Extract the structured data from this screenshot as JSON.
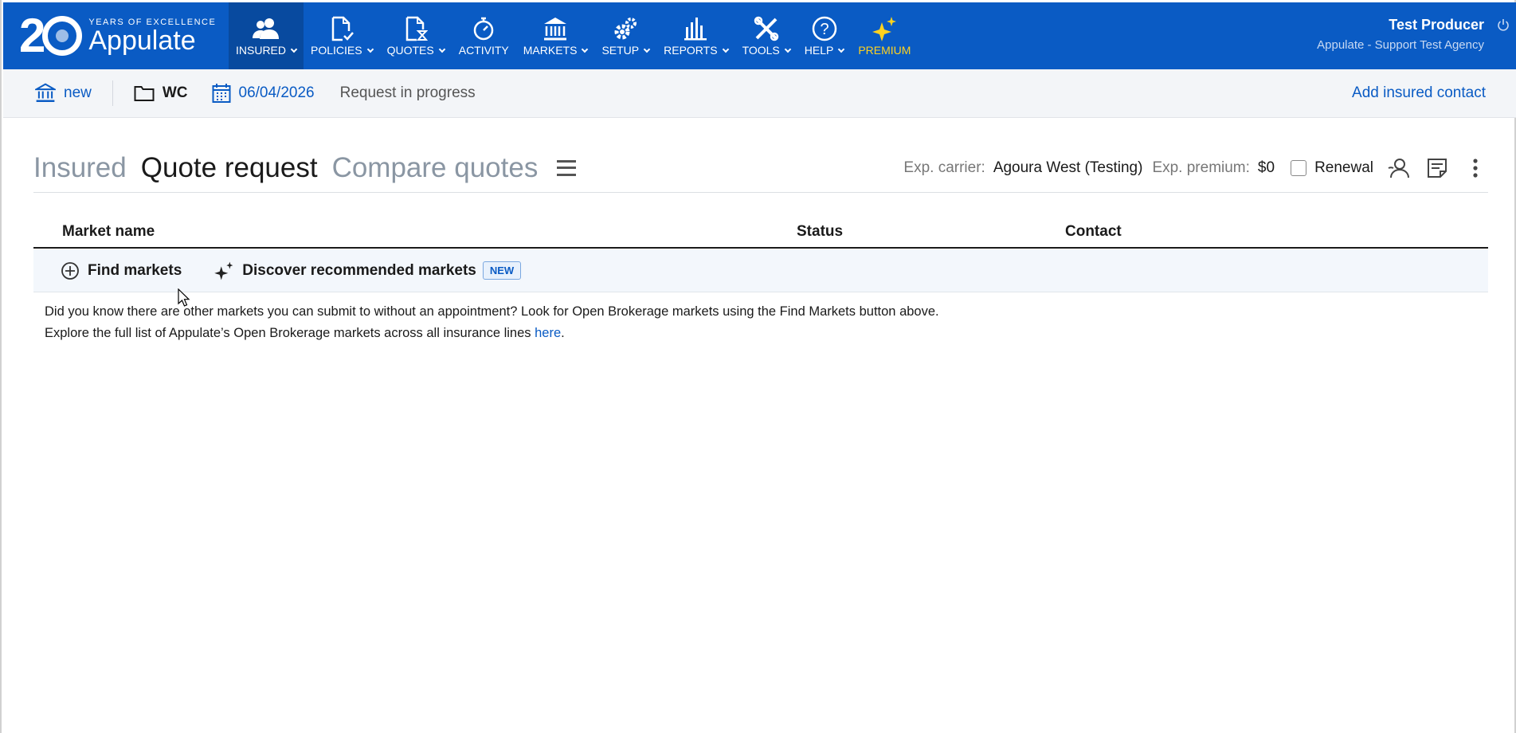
{
  "logo": {
    "years": "20",
    "subtitle": "YEARS OF EXCELLENCE",
    "name": "Appulate"
  },
  "nav": [
    {
      "label": "INSURED",
      "icon": "users-icon",
      "caret": true
    },
    {
      "label": "POLICIES",
      "icon": "document-check-icon",
      "caret": true
    },
    {
      "label": "QUOTES",
      "icon": "document-hourglass-icon",
      "caret": true
    },
    {
      "label": "ACTIVITY",
      "icon": "stopwatch-icon",
      "caret": false
    },
    {
      "label": "MARKETS",
      "icon": "bank-icon",
      "caret": true
    },
    {
      "label": "SETUP",
      "icon": "gears-icon",
      "caret": true
    },
    {
      "label": "REPORTS",
      "icon": "bar-chart-icon",
      "caret": true
    },
    {
      "label": "TOOLS",
      "icon": "wrench-screwdriver-icon",
      "caret": true
    },
    {
      "label": "HELP",
      "icon": "question-circle-icon",
      "caret": true
    },
    {
      "label": "PREMIUM",
      "icon": "sparkle-icon",
      "caret": false
    }
  ],
  "user": {
    "name": "Test Producer",
    "agency": "Appulate - Support Test Agency"
  },
  "subbar": {
    "insured_label": "new",
    "line": "WC",
    "date": "06/04/2026",
    "status": "Request in progress",
    "add_contact": "Add insured contact"
  },
  "tabs": {
    "insured": "Insured",
    "quote_request": "Quote request",
    "compare": "Compare quotes"
  },
  "exp": {
    "carrier_label": "Exp. carrier:",
    "carrier_value": "Agoura West (Testing)",
    "premium_label": "Exp. premium:",
    "premium_value": "$0",
    "renewal_label": "Renewal"
  },
  "table": {
    "col_market": "Market name",
    "col_status": "Status",
    "col_contact": "Contact"
  },
  "actions": {
    "find": "Find markets",
    "discover": "Discover recommended markets",
    "badge": "NEW"
  },
  "info": {
    "line1": "Did you know there are other markets you can submit to without an appointment? Look for Open Brokerage markets using the Find Markets button above.",
    "line2_prefix": "Explore the full list of Appulate’s Open Brokerage markets across all insurance lines ",
    "line2_link": "here",
    "line2_suffix": "."
  },
  "colors": {
    "brand": "#0a5bc4",
    "premium": "#ffd21f"
  }
}
